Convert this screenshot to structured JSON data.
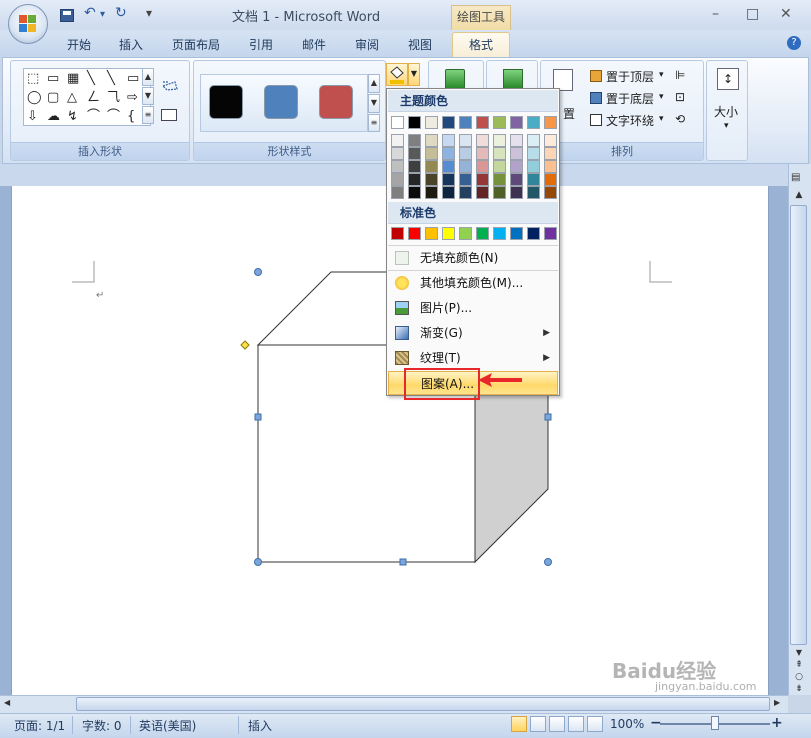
{
  "titlebar": {
    "title": "文档 1 - Microsoft Word",
    "context_tools": "绘图工具",
    "undo_symbol": "↶",
    "redo_symbol": "↻",
    "qat_more": "▾",
    "minimize": "–",
    "maximize": "□",
    "close": "✕"
  },
  "tabs": {
    "home": "开始",
    "insert": "插入",
    "layout": "页面布局",
    "references": "引用",
    "mailings": "邮件",
    "review": "审阅",
    "view": "视图",
    "format": "格式",
    "help": "?"
  },
  "ribbon": {
    "insert_shapes_label": "插入形状",
    "shape_styles_label": "形状样式",
    "arrange_label": "排列",
    "bring_to_front": "置于顶层",
    "send_to_back": "置于底层",
    "text_wrap": "文字环绕",
    "position_partial": "置",
    "size_label": "大小",
    "shape_glyphs": [
      "⬚",
      "▭",
      "▦",
      "╲",
      "╲",
      "▭",
      "◯",
      "▢",
      "△",
      "ㄥ",
      "⺄",
      "⇨",
      "⇩",
      "☁",
      "↯",
      "⌒",
      "⌒",
      "{"
    ],
    "style_colors": [
      "#050505",
      "#4f81bd",
      "#c0504d"
    ]
  },
  "menu": {
    "theme_colors_header": "主题颜色",
    "standard_colors_header": "标准色",
    "theme_top_row": [
      "#ffffff",
      "#000000",
      "#eeece1",
      "#1f497d",
      "#4f81bd",
      "#c0504d",
      "#9bbb59",
      "#8064a2",
      "#4bacc6",
      "#f79646"
    ],
    "theme_shades": [
      [
        "#f2f2f2",
        "#7f7f7f",
        "#ddd9c3",
        "#c6d9f0",
        "#dbe5f1",
        "#f2dcdb",
        "#ebf1dd",
        "#e5e0ec",
        "#dbeef3",
        "#fdeada"
      ],
      [
        "#d8d8d8",
        "#595959",
        "#c4bd97",
        "#8db3e2",
        "#b8cce4",
        "#e5b9b7",
        "#d7e3bc",
        "#ccc1d9",
        "#b7dde8",
        "#fbd5b5"
      ],
      [
        "#bfbfbf",
        "#3f3f3f",
        "#938953",
        "#548dd4",
        "#95b3d7",
        "#d99694",
        "#c3d69b",
        "#b2a2c7",
        "#92cddc",
        "#fac08f"
      ],
      [
        "#a5a5a5",
        "#262626",
        "#494429",
        "#17365d",
        "#366092",
        "#953734",
        "#76923c",
        "#5f497a",
        "#31859b",
        "#e36c09"
      ],
      [
        "#7f7f7f",
        "#0c0c0c",
        "#1d1b10",
        "#0f243e",
        "#244061",
        "#632423",
        "#4f6128",
        "#3f3151",
        "#205867",
        "#974806"
      ]
    ],
    "standard_colors": [
      "#c00000",
      "#ff0000",
      "#ffc000",
      "#ffff00",
      "#92d050",
      "#00b050",
      "#00b0f0",
      "#0070c0",
      "#002060",
      "#7030a0"
    ],
    "no_fill": "无填充颜色(N)",
    "more_fill_colors": "其他填充颜色(M)...",
    "picture": "图片(P)...",
    "gradient": "渐变(G)",
    "texture": "纹理(T)",
    "pattern": "图案(A)..."
  },
  "statusbar": {
    "page": "页面: 1/1",
    "words": "字数: 0",
    "language": "英语(美国)",
    "mode": "插入",
    "zoom": "100%",
    "zoom_minus": "−",
    "zoom_plus": "+"
  },
  "watermark": {
    "brand": "Baidu经验",
    "url": "jingyan.baidu.com"
  }
}
